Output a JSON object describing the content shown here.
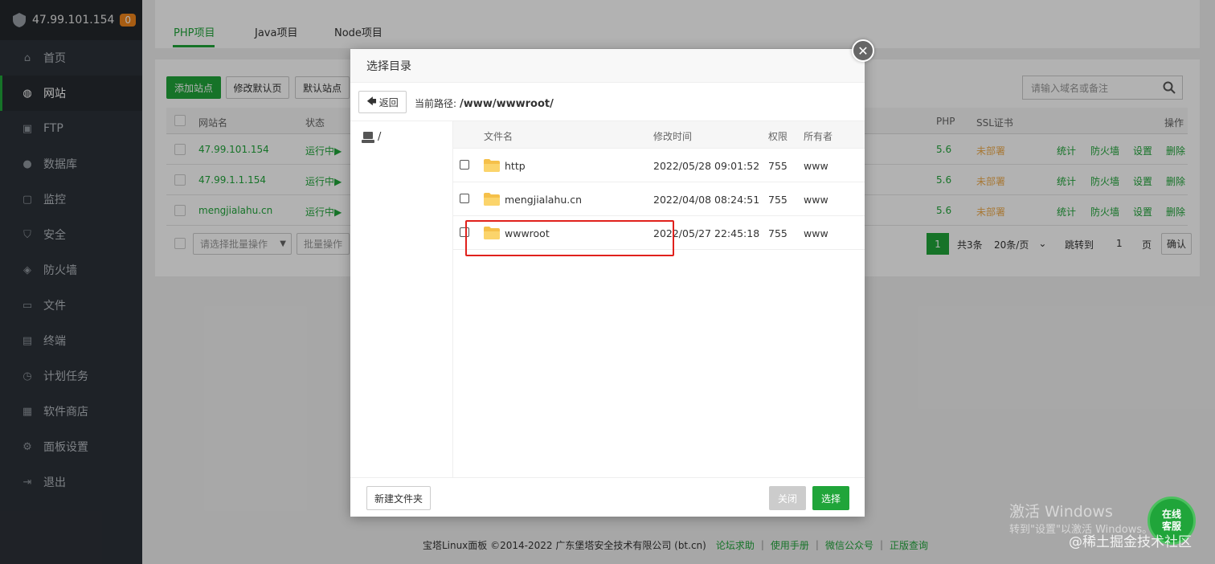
{
  "sidebar": {
    "ip": "47.99.101.154",
    "badge": "0",
    "items": [
      {
        "label": "首页",
        "icon": "home-icon"
      },
      {
        "label": "网站",
        "icon": "globe-icon"
      },
      {
        "label": "FTP",
        "icon": "ftp-icon"
      },
      {
        "label": "数据库",
        "icon": "database-icon"
      },
      {
        "label": "监控",
        "icon": "monitor-icon"
      },
      {
        "label": "安全",
        "icon": "shield-icon"
      },
      {
        "label": "防火墙",
        "icon": "firewall-icon"
      },
      {
        "label": "文件",
        "icon": "folder-icon"
      },
      {
        "label": "终端",
        "icon": "terminal-icon"
      },
      {
        "label": "计划任务",
        "icon": "clock-icon"
      },
      {
        "label": "软件商店",
        "icon": "grid-icon"
      },
      {
        "label": "面板设置",
        "icon": "gear-icon"
      },
      {
        "label": "退出",
        "icon": "logout-icon"
      }
    ]
  },
  "tabs": [
    "PHP项目",
    "Java项目",
    "Node项目"
  ],
  "toolbar": {
    "add_site": "添加站点",
    "modify_default": "修改默认页",
    "default_site": "默认站点",
    "search_placeholder": "请输入域名或备注"
  },
  "table": {
    "headers": {
      "name": "网站名",
      "status": "状态",
      "php": "PHP",
      "ssl": "SSL证书",
      "ops": "操作"
    },
    "rows": [
      {
        "name": "47.99.101.154",
        "status": "运行中▶",
        "php": "5.6",
        "ssl": "未部署"
      },
      {
        "name": "47.99.1.1.154",
        "status": "运行中▶",
        "php": "5.6",
        "ssl": "未部署"
      },
      {
        "name": "mengjialahu.cn",
        "status": "运行中▶",
        "php": "5.6",
        "ssl": "未部署"
      }
    ],
    "ops": [
      "统计",
      "防火墙",
      "设置",
      "删除"
    ],
    "batch_placeholder": "请选择批量操作",
    "batch_button": "批量操作"
  },
  "pager": {
    "current": "1",
    "total": "共3条",
    "per_page": "20条/页",
    "jump_label": "跳转到",
    "jump_value": "1",
    "page_unit": "页",
    "confirm": "确认"
  },
  "footer": {
    "copyright": "宝塔Linux面板 ©2014-2022 广东堡塔安全技术有限公司 (bt.cn)",
    "links": [
      "论坛求助",
      "使用手册",
      "微信公众号",
      "正版查询"
    ]
  },
  "dialog": {
    "title": "选择目录",
    "back": "返回",
    "path_label": "当前路径:",
    "path_value": "/www/wwwroot/",
    "tree_root": "/",
    "columns": {
      "name": "文件名",
      "mtime": "修改时间",
      "perm": "权限",
      "owner": "所有者"
    },
    "files": [
      {
        "name": "http",
        "mtime": "2022/05/28 09:01:52",
        "perm": "755",
        "owner": "www"
      },
      {
        "name": "mengjialahu.cn",
        "mtime": "2022/04/08 08:24:51",
        "perm": "755",
        "owner": "www"
      },
      {
        "name": "wwwroot",
        "mtime": "2022/05/27 22:45:18",
        "perm": "755",
        "owner": "www"
      }
    ],
    "new_folder": "新建文件夹",
    "close": "关闭",
    "select": "选择"
  },
  "watermarks": {
    "windows_line1": "激活 Windows",
    "windows_line2": "转到\"设置\"以激活 Windows。",
    "juejin": "@稀土掘金技术社区"
  },
  "kefu": {
    "line1": "在线",
    "line2": "客服"
  },
  "colors": {
    "accent": "#20a53a",
    "highlight": "#e0211c",
    "sidebar": "#2c3138"
  }
}
